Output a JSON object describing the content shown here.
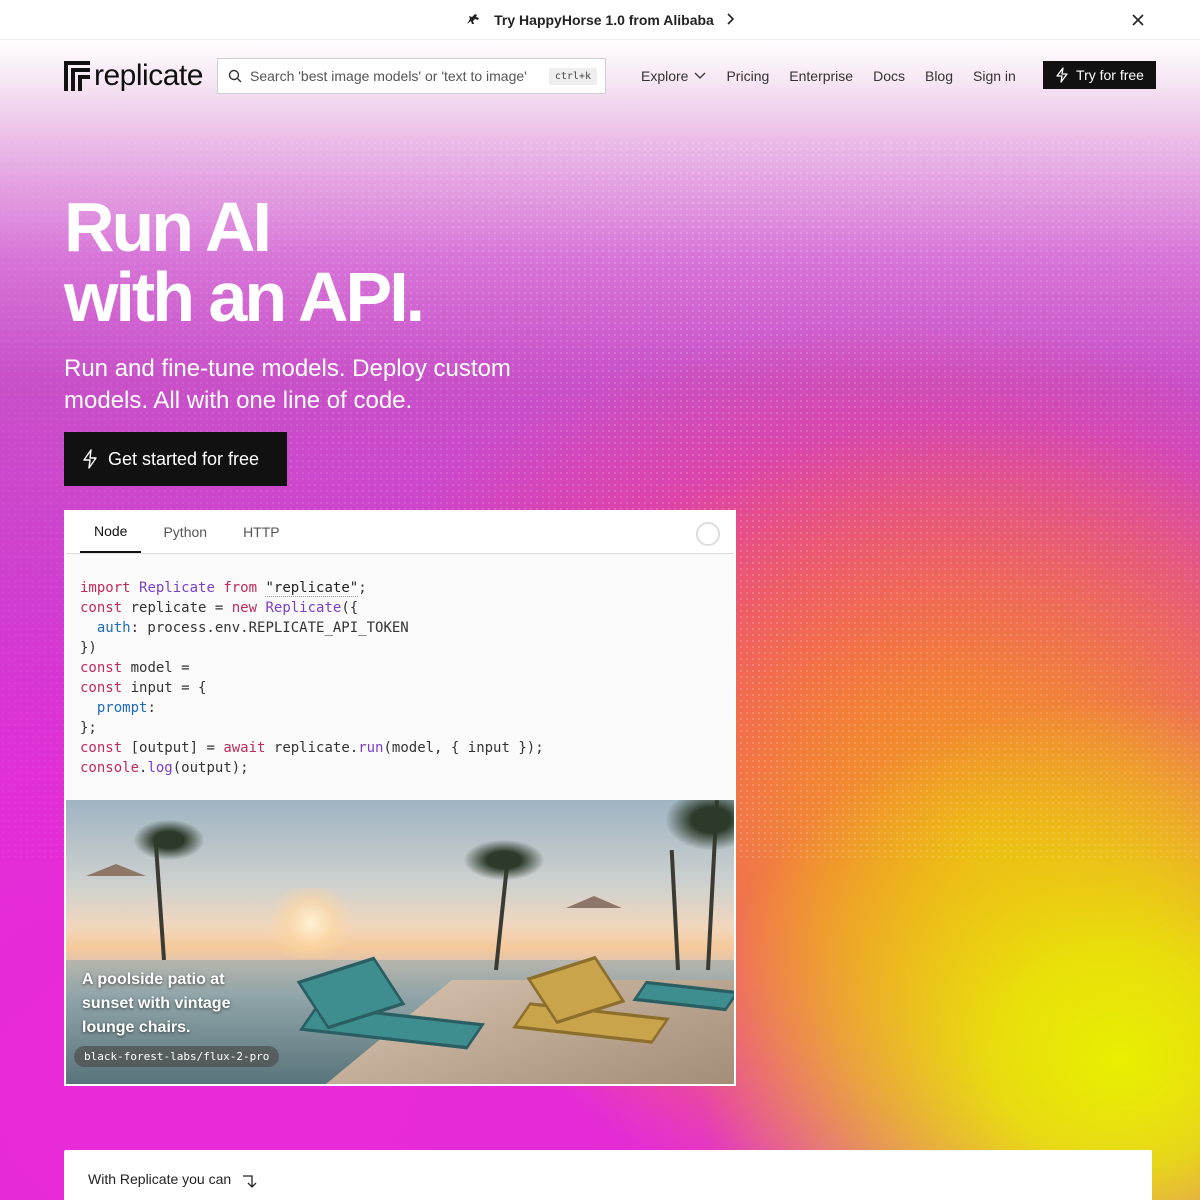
{
  "announcement": {
    "text": "Try HappyHorse 1.0 from Alibaba",
    "icon": "horse-icon"
  },
  "nav": {
    "logo_text": "replicate",
    "search_placeholder": "Search 'best image models' or 'text to image'",
    "search_shortcut": "ctrl+k",
    "links": [
      "Explore",
      "Pricing",
      "Enterprise",
      "Docs",
      "Blog",
      "Sign in"
    ],
    "cta": "Try for free"
  },
  "hero": {
    "title_line1": "Run AI",
    "title_line2": "with an API.",
    "subtitle": "Run and fine-tune models. Deploy custom models. All with one line of code.",
    "cta": "Get started for free"
  },
  "code_card": {
    "tabs": [
      "Node",
      "Python",
      "HTTP"
    ],
    "active_tab": "Node",
    "code_lines": [
      "import Replicate from \"replicate\";",
      "const replicate = new Replicate({",
      "  auth: process.env.REPLICATE_API_TOKEN",
      "})",
      "const model =",
      "const input = {",
      "  prompt:",
      "};",
      "const [output] = await replicate.run(model, { input });",
      "console.log(output);"
    ],
    "image_caption": "A poolside patio at sunset with vintage lounge chairs.",
    "model_name": "black-forest-labs/flux-2-pro"
  },
  "bottom": {
    "label": "With Replicate you can"
  },
  "colors": {
    "keyword": "#c02a5a",
    "class": "#7b3fc9",
    "property": "#1e6bb8",
    "accent_dark": "#111111"
  }
}
